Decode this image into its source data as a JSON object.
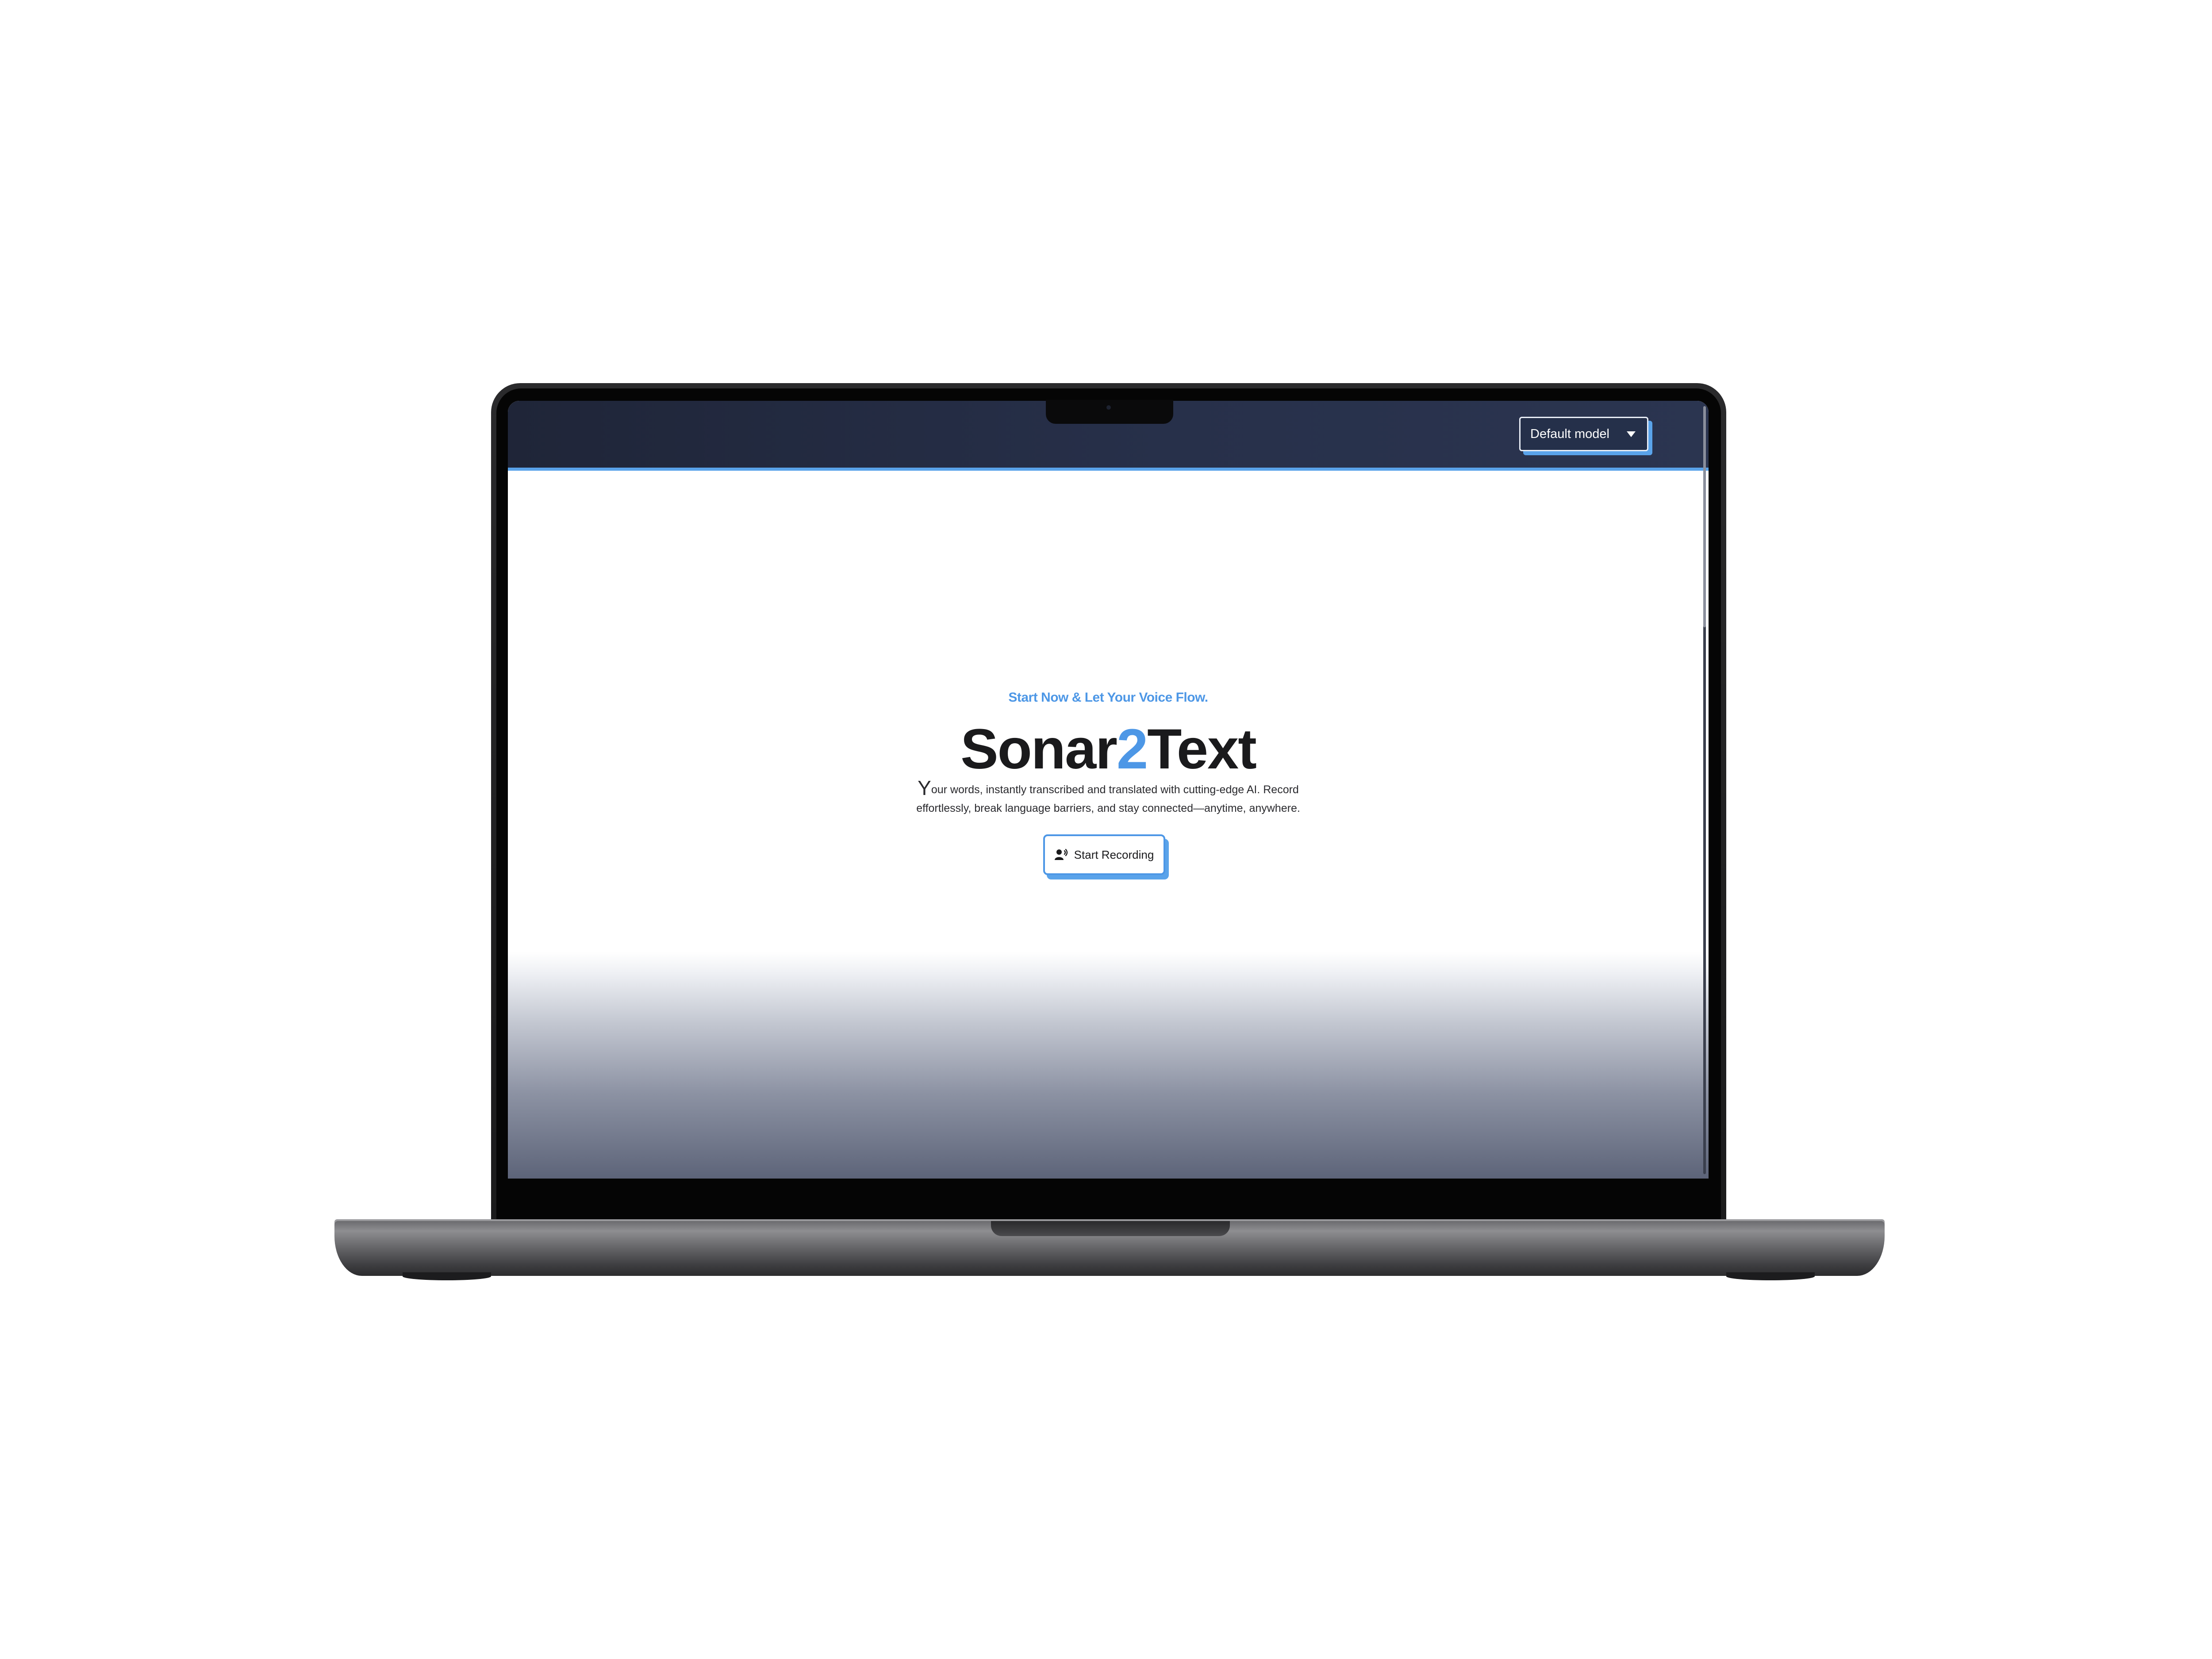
{
  "header": {
    "model_select": {
      "value": "Default model",
      "caret_icon": "caret-down-icon"
    }
  },
  "hero": {
    "tagline": "Start Now & Let Your Voice Flow.",
    "brand": {
      "part1": "Sonar",
      "part2": "2",
      "part3": "Text"
    },
    "description": {
      "dropcap": "Y",
      "rest": "our words, instantly transcribed and translated with cutting-edge AI. Record effortlessly, break language barriers, and stay connected—anytime, anywhere."
    },
    "record_button": {
      "label": "Start Recording",
      "icon": "voice-user-icon"
    }
  },
  "colors": {
    "accent": "#4d97e6",
    "header_bg": "#25304a",
    "text": "#1a1a1c"
  }
}
